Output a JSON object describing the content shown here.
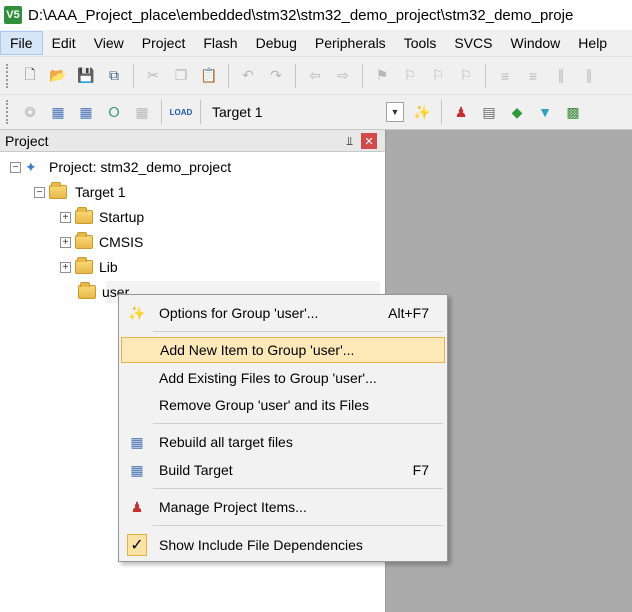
{
  "window": {
    "app_icon_text": "V5",
    "title": "D:\\AAA_Project_place\\embedded\\stm32\\stm32_demo_project\\stm32_demo_proje"
  },
  "menubar": {
    "items": [
      "File",
      "Edit",
      "View",
      "Project",
      "Flash",
      "Debug",
      "Peripherals",
      "Tools",
      "SVCS",
      "Window",
      "Help"
    ]
  },
  "toolbar2": {
    "target_value": "Target 1",
    "load_label": "LOAD"
  },
  "project_panel": {
    "title": "Project",
    "tree": {
      "project": "Project: stm32_demo_project",
      "target": "Target 1",
      "groups": [
        "Startup",
        "CMSIS",
        "Lib",
        "user"
      ]
    }
  },
  "context_menu": {
    "items": [
      {
        "label": "Options for Group 'user'...",
        "shortcut": "Alt+F7",
        "icon": "magic-wand-icon"
      },
      {
        "label": "Add New  Item to Group 'user'...",
        "shortcut": "",
        "icon": ""
      },
      {
        "label": "Add Existing Files to Group 'user'...",
        "shortcut": "",
        "icon": ""
      },
      {
        "label": "Remove Group 'user' and its Files",
        "shortcut": "",
        "icon": ""
      },
      {
        "label": "Rebuild all target files",
        "shortcut": "",
        "icon": "rebuild-icon"
      },
      {
        "label": "Build Target",
        "shortcut": "F7",
        "icon": "build-icon"
      },
      {
        "label": "Manage Project Items...",
        "shortcut": "",
        "icon": "manage-items-icon"
      },
      {
        "label": "Show Include File Dependencies",
        "shortcut": "",
        "icon": "checkmark-icon"
      }
    ]
  },
  "colors": {
    "menu_hover": "#fde8b8",
    "workspace_gray": "#ababab"
  }
}
